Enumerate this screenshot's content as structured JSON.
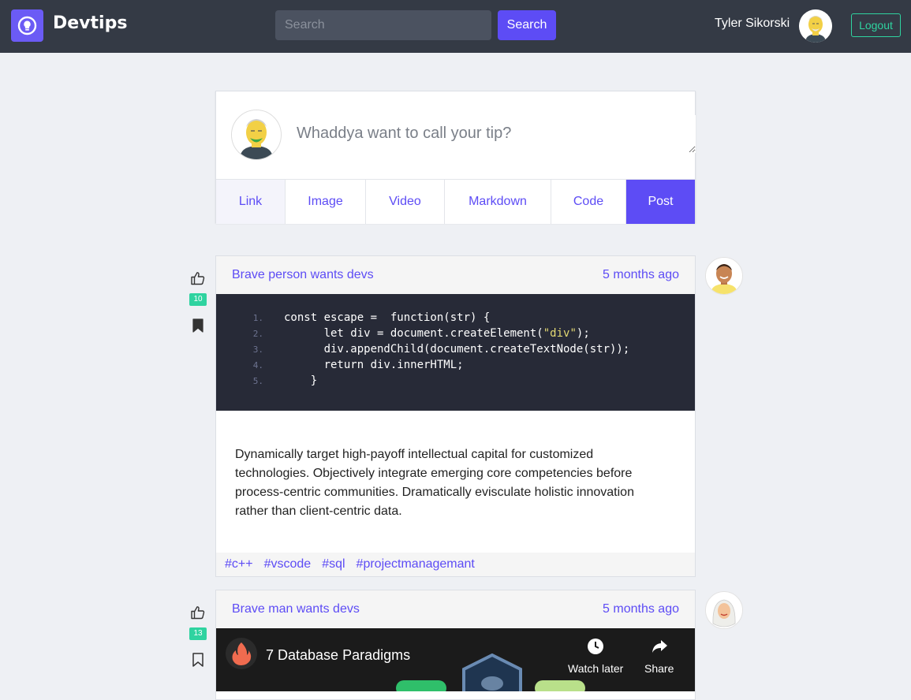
{
  "navbar": {
    "brand": "Devtips",
    "search_placeholder": "Search",
    "search_button": "Search",
    "user_name": "Tyler Sikorski",
    "logout_label": "Logout"
  },
  "composer": {
    "title_placeholder": "Whaddya want to call your tip?",
    "tabs": [
      "Link",
      "Image",
      "Video",
      "Markdown",
      "Code",
      "Post"
    ]
  },
  "posts": [
    {
      "title": "Brave person wants devs",
      "time": "5 months ago",
      "likes": "10",
      "bookmarked": true,
      "code_lines": [
        {
          "num": "1.",
          "text": "const escape =  function(str) {"
        },
        {
          "num": "2.",
          "text": "      let div = document.createElement(\"div\");"
        },
        {
          "num": "3.",
          "text": "      div.appendChild(document.createTextNode(str));"
        },
        {
          "num": "4.",
          "text": "      return div.innerHTML;"
        },
        {
          "num": "5.",
          "text": "    }"
        }
      ],
      "body": "Dynamically target high-payoff intellectual capital for customized technologies. Objectively integrate emerging core competencies before process-centric communities. Dramatically evisculate holistic innovation rather than client-centric data.",
      "tags": [
        "#c++",
        "#vscode",
        "#sql",
        "#projectmanagemant"
      ]
    },
    {
      "title": "Brave man wants devs",
      "time": "5 months ago",
      "likes": "13",
      "bookmarked": false,
      "video": {
        "title": "7 Database Paradigms",
        "watch_later": "Watch later",
        "share": "Share"
      }
    }
  ],
  "colors": {
    "accent": "#5d4cf5",
    "navbar": "#343a45",
    "badge": "#2fd3a0",
    "code_bg": "#272a37"
  }
}
